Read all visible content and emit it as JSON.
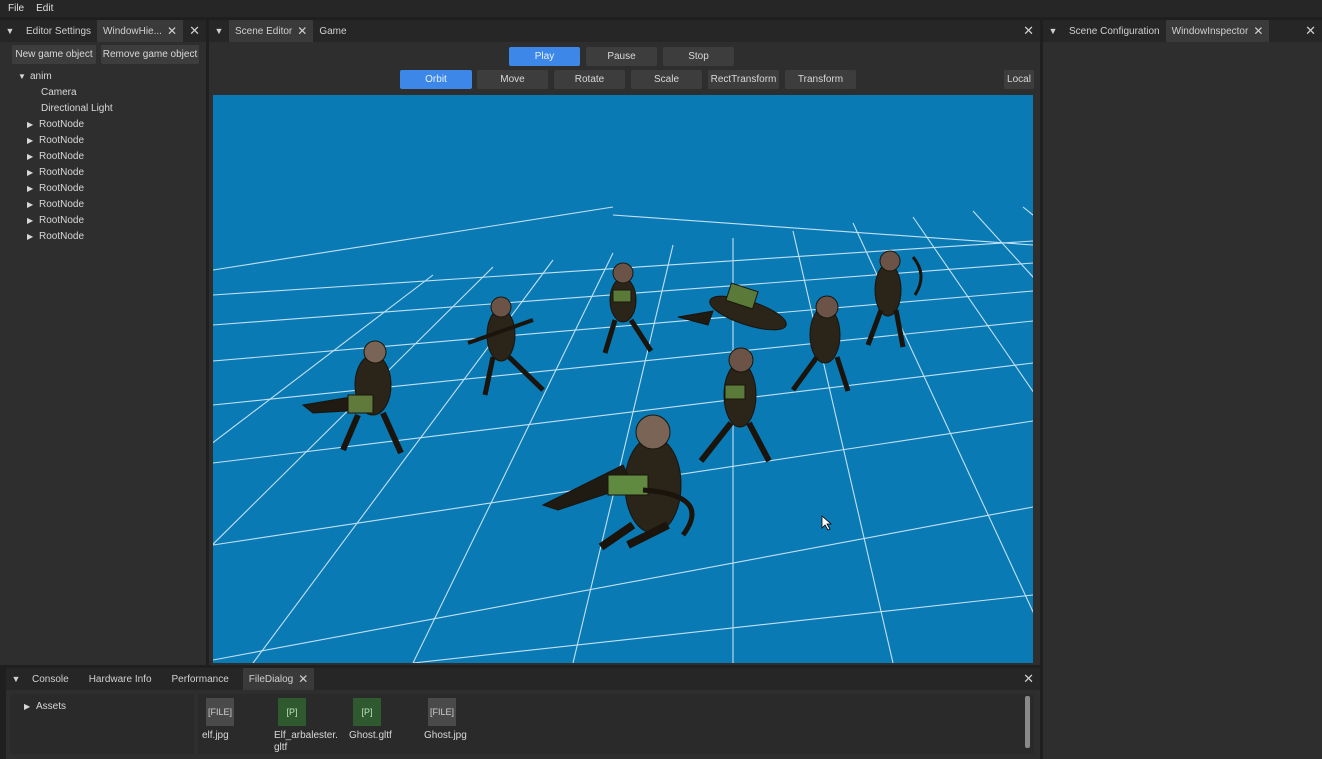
{
  "menu": {
    "file": "File",
    "edit": "Edit"
  },
  "left_panel": {
    "tabs": [
      "Editor Settings",
      "WindowHie..."
    ],
    "buttons": {
      "new": "New game object",
      "remove": "Remove game object"
    },
    "tree": {
      "root": "anim",
      "children": [
        "Camera",
        "Directional Light",
        "RootNode",
        "RootNode",
        "RootNode",
        "RootNode",
        "RootNode",
        "RootNode",
        "RootNode",
        "RootNode"
      ]
    }
  },
  "center_panel": {
    "tabs": [
      "Scene Editor",
      "Game"
    ],
    "playback": [
      "Play",
      "Pause",
      "Stop"
    ],
    "tools": [
      "Orbit",
      "Move",
      "Rotate",
      "Scale",
      "RectTransform",
      "Transform"
    ],
    "space_toggle": "Local",
    "active_playback": "Play",
    "active_tool": "Orbit"
  },
  "right_panel": {
    "tabs": [
      "Scene Configuration",
      "WindowInspector"
    ]
  },
  "bottom_panel": {
    "tabs": [
      "Console",
      "Hardware Info",
      "Performance",
      "FileDialog"
    ],
    "tree_root": "Assets",
    "files": [
      {
        "badge": "[FILE]",
        "name": "elf.jpg",
        "kind": "file"
      },
      {
        "badge": "[P]",
        "name": "Elf_arbalester.\ngltf",
        "kind": "prefab"
      },
      {
        "badge": "[P]",
        "name": "Ghost.gltf",
        "kind": "prefab"
      },
      {
        "badge": "[FILE]",
        "name": "Ghost.jpg",
        "kind": "file"
      }
    ]
  },
  "colors": {
    "viewport_bg": "#0a7ab5",
    "accent": "#3c87e8",
    "grid": "#dff2ff",
    "prefab": "#2f5a2f"
  }
}
